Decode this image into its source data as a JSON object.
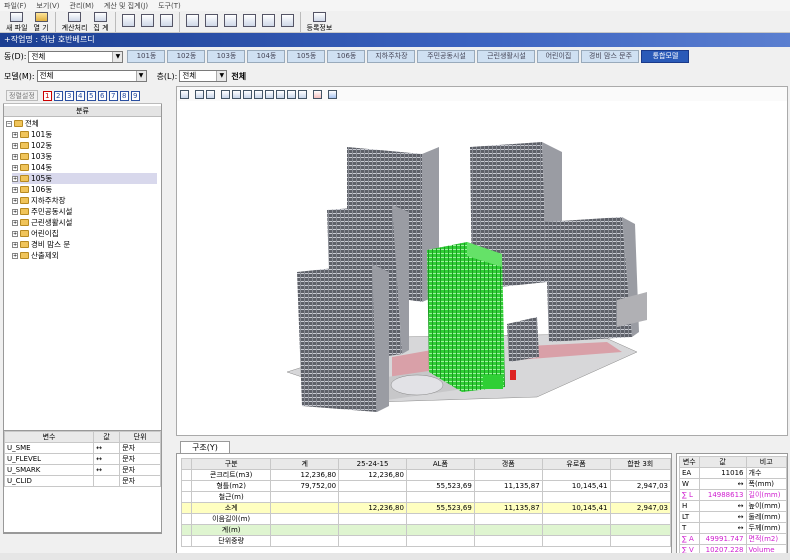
{
  "menu": [
    "파일(F)",
    "보기(V)",
    "관리(M)",
    "계산 및 집계(J)",
    "도구(T)"
  ],
  "toolbar": {
    "new_file": "새 파일",
    "open": "열 기",
    "calculate": "계산처리",
    "aggregate": "집 계",
    "register": "등록정보"
  },
  "project_title": "+작업명 : 하남 호반베르디",
  "dong_label": "동(D):",
  "dong_value": "전체",
  "tabs": [
    "101동",
    "102동",
    "103동",
    "104동",
    "105동",
    "106동",
    "지하주차장",
    "주민공동시설",
    "근린생활시설",
    "어린이집",
    "경비 맘스 문주",
    "통합모델"
  ],
  "active_tab": 11,
  "model_label": "모델(M):",
  "model_value": "전체",
  "floor_label": "층(L):",
  "floor_value": "전체",
  "floor_text": "전체",
  "left_tools": {
    "title_btn": "정렬설정",
    "numbers": [
      "1",
      "2",
      "3",
      "4",
      "5",
      "6",
      "7",
      "8",
      "9"
    ]
  },
  "tree": {
    "header": "분류",
    "root": "전체",
    "items": [
      "101동",
      "102동",
      "103동",
      "104동",
      "105동",
      "106동",
      "지하주차장",
      "주민공동시설",
      "근린생활시설",
      "어린이집",
      "경비 맘스 문",
      "산출제외"
    ],
    "selected": 4
  },
  "var_table": {
    "headers": [
      "변수",
      "값",
      "단위"
    ],
    "rows": [
      [
        "U_SME",
        "↔",
        "문자"
      ],
      [
        "U_FLEVEL",
        "↔",
        "문자"
      ],
      [
        "U_SMARK",
        "↔",
        "문자"
      ],
      [
        "U_CLID",
        "",
        "문자"
      ]
    ]
  },
  "struct": {
    "tab": "구조(Y)",
    "headers": [
      "구분",
      "계",
      "25-24-15",
      "AL폼",
      "갱폼",
      "유로폼",
      "합판 3회"
    ],
    "rows": [
      [
        "콘크리트(m3)",
        "12,236,80",
        "12,236,80",
        "",
        "",
        "",
        ""
      ],
      [
        "형틀(m2)",
        "79,752,00",
        "",
        "55,523,69",
        "11,135,87",
        "10,145,41",
        "2,947,03"
      ],
      [
        "철근(m)",
        "",
        "",
        "",
        "",
        "",
        ""
      ],
      [
        "소계",
        "",
        "12,236,80",
        "55,523,69",
        "11,135,87",
        "10,145,41",
        "2,947,03"
      ],
      [
        "이음길이(m)",
        "",
        "",
        "",
        "",
        "",
        ""
      ],
      [
        "계(m)",
        "",
        "",
        "",
        "",
        "",
        ""
      ],
      [
        "단위중량",
        "",
        "",
        "",
        "",
        "",
        ""
      ]
    ]
  },
  "right_table": {
    "headers": [
      "변수",
      "값",
      "비고"
    ],
    "rows": [
      [
        "EA",
        "11016",
        "개수"
      ],
      [
        "W",
        "↔",
        "폭(mm)"
      ],
      [
        "∑ L",
        "14988613",
        "길이(mm)"
      ],
      [
        "H",
        "↔",
        "높이(mm)"
      ],
      [
        "LT",
        "↔",
        "둘레(mm)"
      ],
      [
        "T",
        "↔",
        "두께(mm)"
      ],
      [
        "∑ A",
        "49991.747",
        "면적(m2)"
      ],
      [
        "∑ V",
        "10207.228",
        "Volume"
      ]
    ]
  },
  "colors": {
    "accent": "#2a5ab8",
    "selected_building": "#36d33a",
    "title_bar": "#1c3f92"
  }
}
